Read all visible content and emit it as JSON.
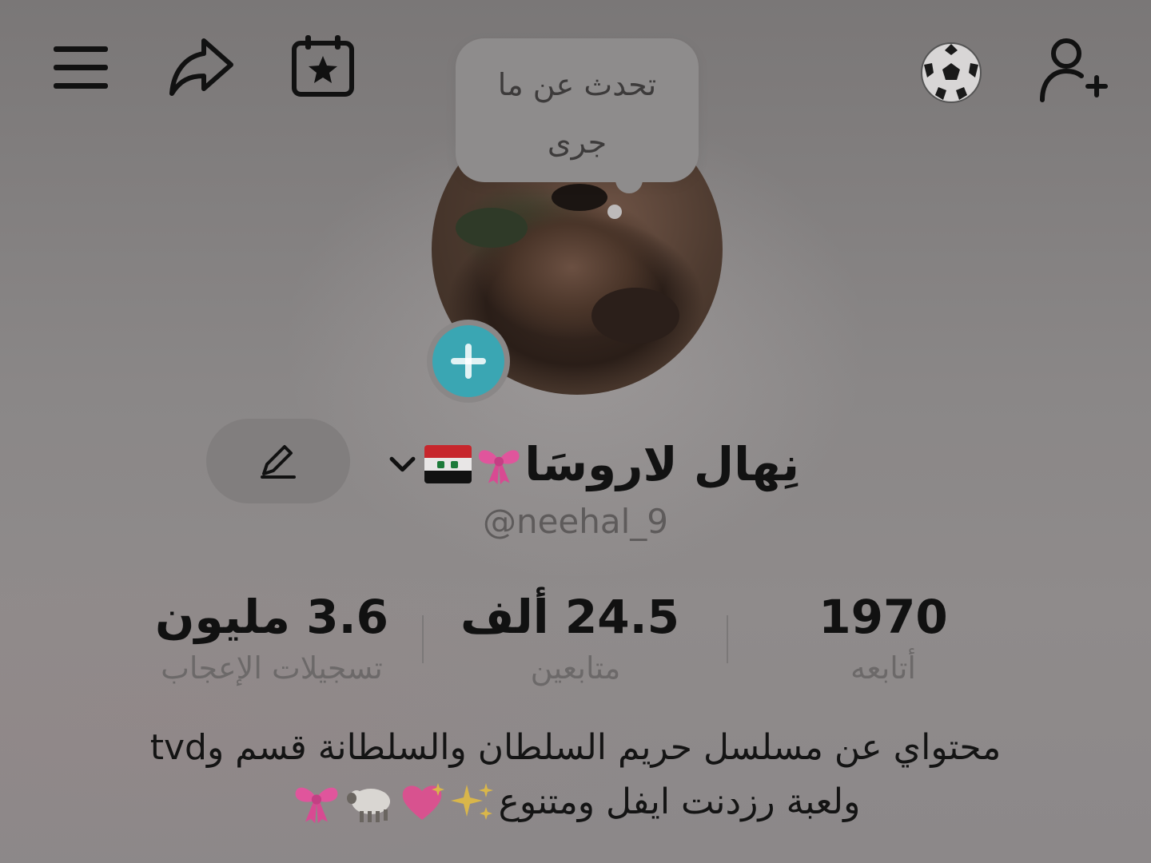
{
  "header": {
    "menu_icon": "hamburger-menu-icon",
    "share_icon": "share-arrow-icon",
    "calendar_icon": "calendar-star-icon",
    "ball_icon": "soccer-ball-icon",
    "add_user_icon": "add-user-icon"
  },
  "bubble": {
    "text_line1": "تحدث عن ما",
    "text_line2": "جرى"
  },
  "profile": {
    "display_name": "نِهال لاروسَا",
    "handle": "@neehal_9",
    "plus_icon": "plus-icon",
    "edit_icon": "pencil-icon",
    "dropdown_icon": "chevron-down-icon"
  },
  "stats": {
    "following": {
      "value": "1970",
      "label": "أتابعه"
    },
    "followers": {
      "value": "24.5 ألف",
      "label": "متابعين"
    },
    "likes": {
      "value": "3.6 مليون",
      "label": "تسجيلات الإعجاب"
    }
  },
  "bio": {
    "line1": "محتواي عن مسلسل حريم السلطان والسلطانة قسم وtvd",
    "line2": "ولعبة رزدنت ايفل ومتنوع"
  },
  "colors": {
    "accent_teal": "#3aa6b3",
    "bow_pink": "#e0559c",
    "heart_pink": "#d8528f"
  }
}
